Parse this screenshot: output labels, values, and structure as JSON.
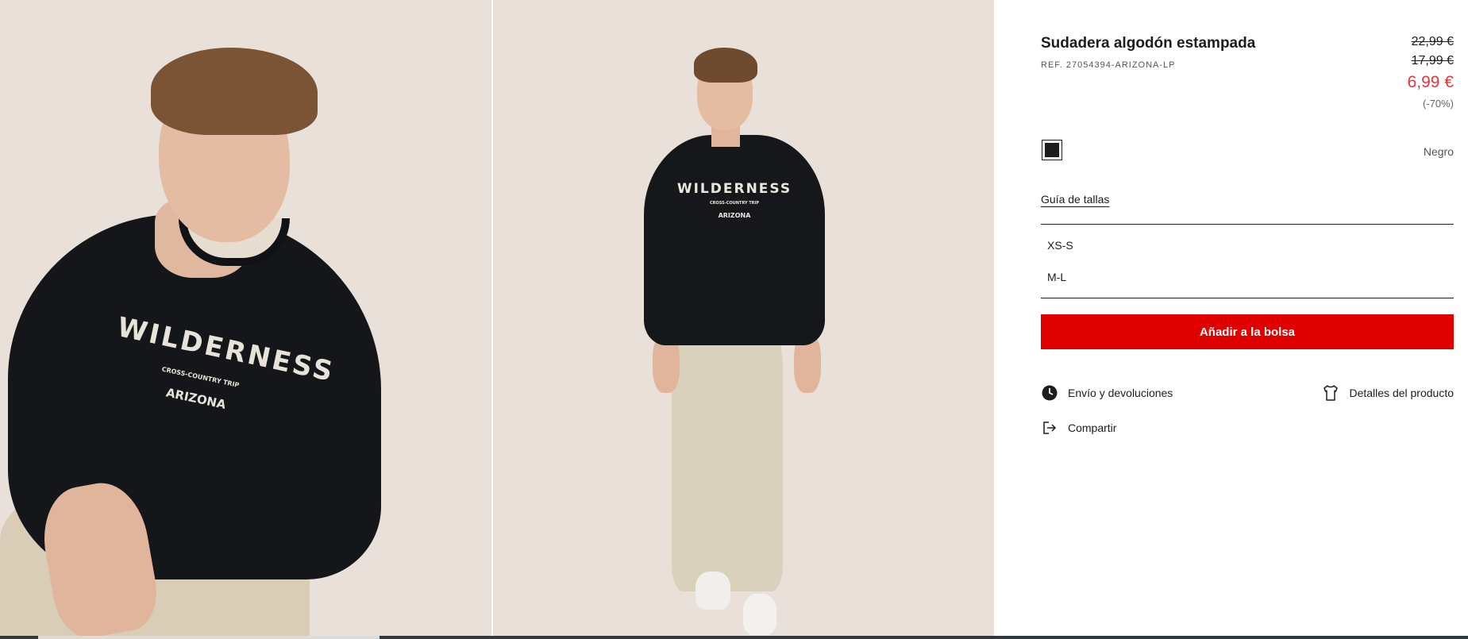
{
  "gallery": {
    "photo1_print": {
      "headline": "WILDERNESS",
      "sub": "CROSS-COUNTRY TRIP",
      "place": "ARIZONA"
    },
    "photo2_print": {
      "headline": "WILDERNESS",
      "sub": "CROSS-COUNTRY TRIP",
      "place": "ARIZONA"
    }
  },
  "product": {
    "title": "Sudadera algodón estampada",
    "ref": "REF. 27054394-ARIZONA-LP",
    "prices": {
      "original": "22,99 €",
      "previous": "17,99 €",
      "current": "6,99 €",
      "discount": "(-70%)"
    },
    "color": {
      "name": "Negro",
      "swatch_hex": "#1d1d1b"
    },
    "size_guide_label": "Guía de tallas",
    "sizes": [
      "XS-S",
      "M-L"
    ],
    "add_to_bag_label": "Añadir a la bolsa",
    "links": {
      "shipping": "Envío y devoluciones",
      "details": "Detalles del producto",
      "share": "Compartir"
    },
    "icons": {
      "shipping": "clock-icon",
      "details": "tshirt-icon",
      "share": "share-icon"
    }
  },
  "colors": {
    "accent_button": "#e00000",
    "sale_price": "#e2363f",
    "text": "#1d1d1b"
  }
}
